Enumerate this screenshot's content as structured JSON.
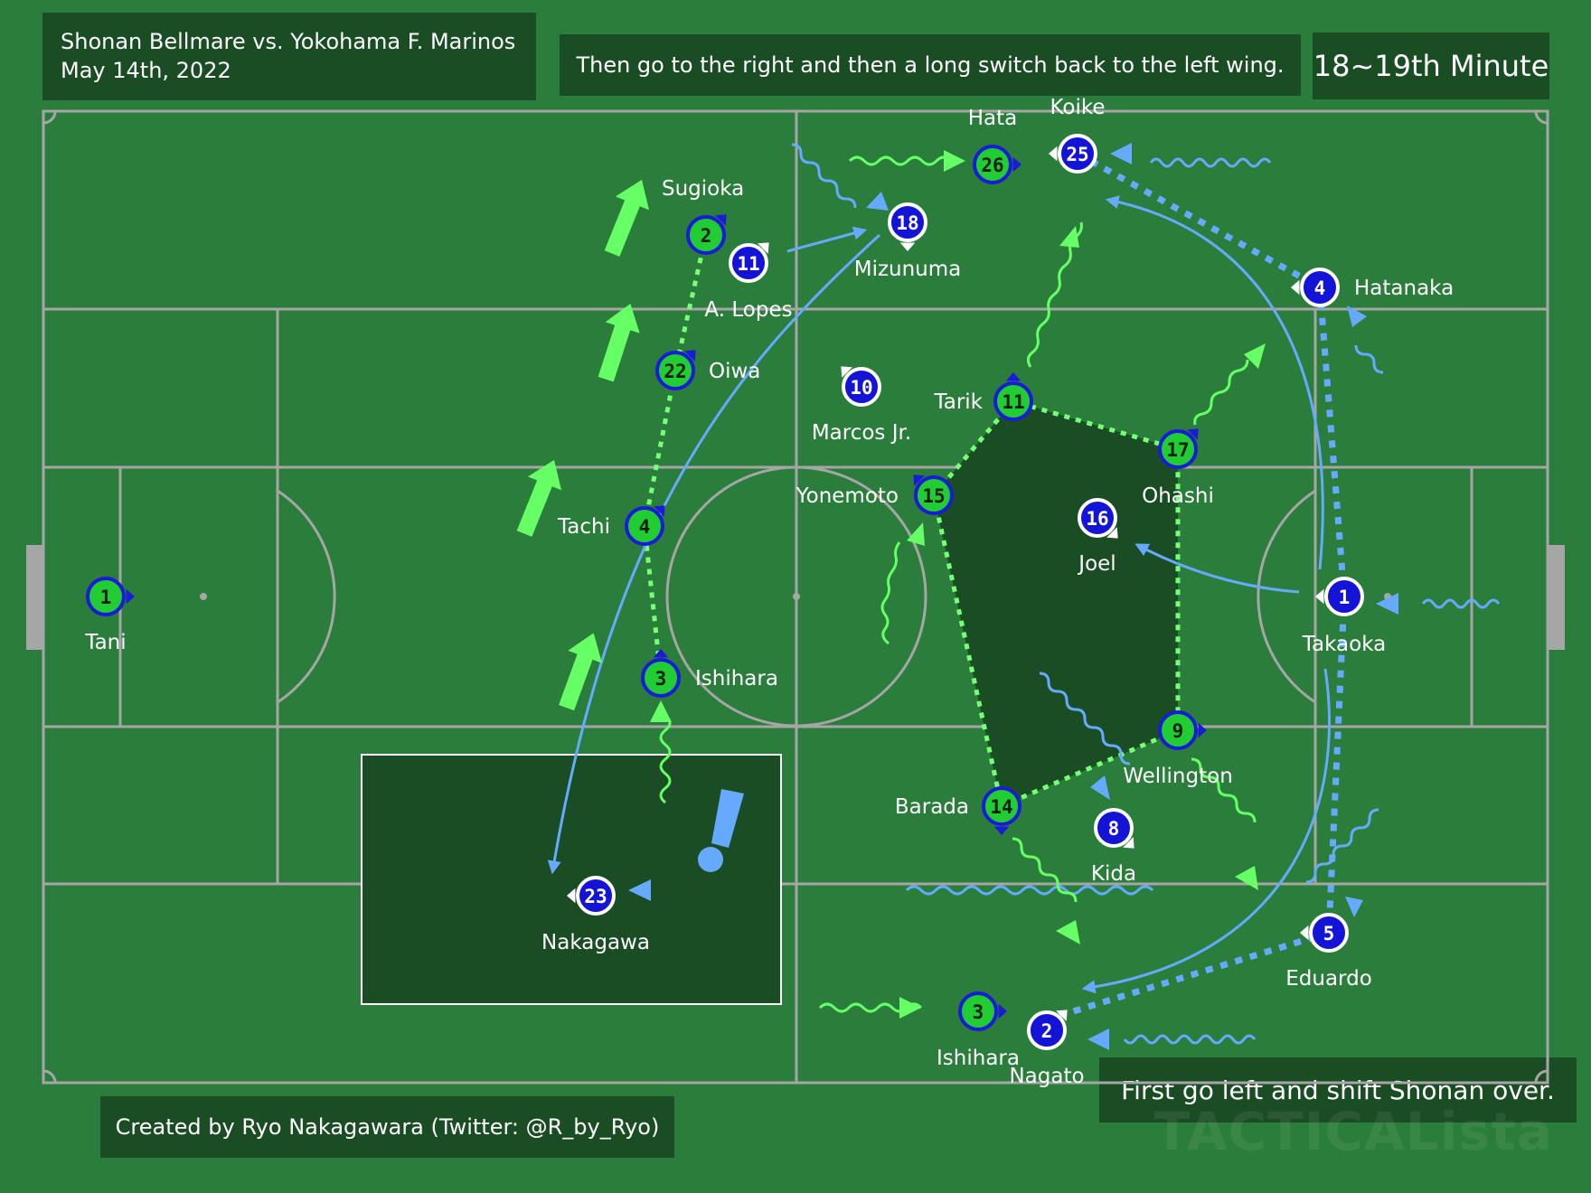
{
  "header": {
    "match": "Shonan Bellmare vs. Yokohama F. Marinos",
    "date": "May 14th, 2022",
    "caption_top": "Then go to the right and then a long switch back to the left wing.",
    "minute": "18~19th Minute"
  },
  "caption_bottom": "First go left and shift Shonan over.",
  "credit": "Created by Ryo Nakagawara (Twitter: @R_by_Ryo)",
  "watermark": "TACTICALista",
  "colors": {
    "pitch": "#2a7d3a",
    "box_bg": "#1a4d24",
    "shonan_fill": "#22cc33",
    "shonan_ring": "#1a1ad9",
    "marinos_fill": "#1414d6",
    "marinos_ring": "#ffffff",
    "pass_green": "#77ff77",
    "pass_blue": "#66aaff",
    "run_green": "#66ff66"
  },
  "shonan_players": [
    {
      "num": "1",
      "name": "Tani"
    },
    {
      "num": "2",
      "name": "Sugioka"
    },
    {
      "num": "22",
      "name": "Oiwa"
    },
    {
      "num": "4",
      "name": "Tachi"
    },
    {
      "num": "3",
      "name": "Ishihara"
    },
    {
      "num": "26",
      "name": "Hata"
    },
    {
      "num": "11",
      "name": "Tarik"
    },
    {
      "num": "15",
      "name": "Yonemoto"
    },
    {
      "num": "17",
      "name": "Ohashi"
    },
    {
      "num": "9",
      "name": "Wellington"
    },
    {
      "num": "14",
      "name": "Barada"
    },
    {
      "num": "3",
      "name": "Ishihara"
    }
  ],
  "marinos_players": [
    {
      "num": "25",
      "name": "Koike"
    },
    {
      "num": "18",
      "name": "Mizunuma"
    },
    {
      "num": "11",
      "name": "A. Lopes"
    },
    {
      "num": "10",
      "name": "Marcos Jr."
    },
    {
      "num": "4",
      "name": "Hatanaka"
    },
    {
      "num": "16",
      "name": "Joel"
    },
    {
      "num": "1",
      "name": "Takaoka"
    },
    {
      "num": "8",
      "name": "Kida"
    },
    {
      "num": "5",
      "name": "Eduardo"
    },
    {
      "num": "2",
      "name": "Nagato"
    },
    {
      "num": "23",
      "name": "Nakagawa"
    }
  ]
}
